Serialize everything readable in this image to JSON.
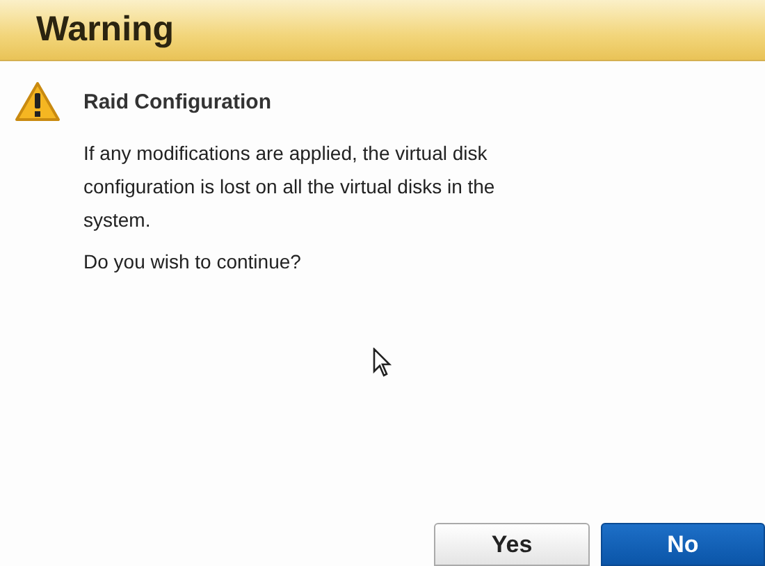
{
  "window": {
    "title": "Warning"
  },
  "heading": "Raid Configuration",
  "message": "If any modifications are applied, the virtual disk configuration is lost on all the virtual disks in the system.",
  "question": "Do you wish to continue?",
  "buttons": [
    {
      "label": "Yes",
      "selected": false
    },
    {
      "label": "No",
      "selected": true
    }
  ]
}
